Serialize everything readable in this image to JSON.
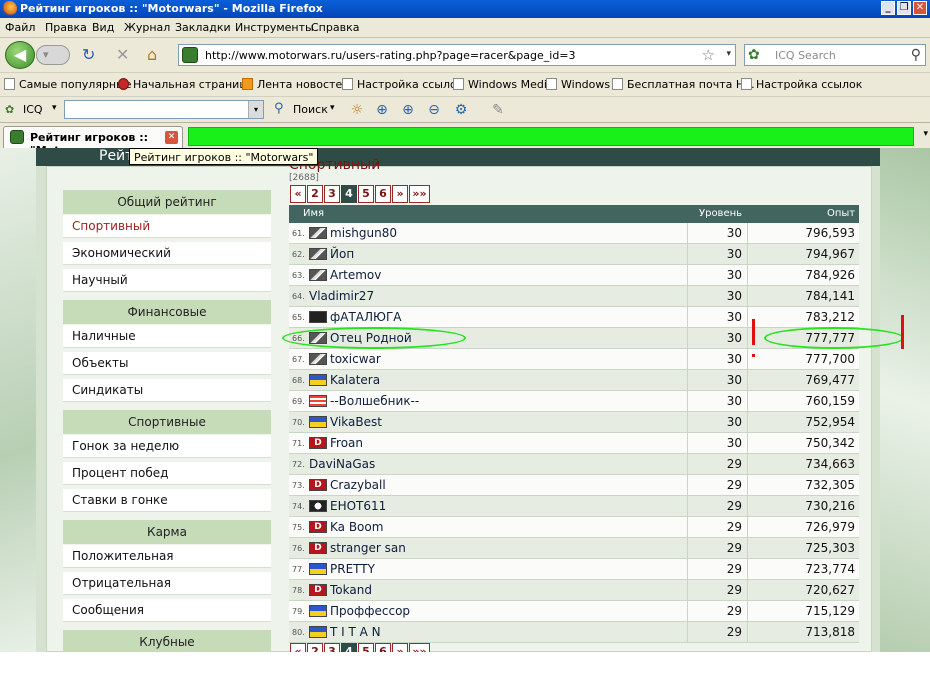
{
  "window": {
    "title": "Рейтинг игроков :: \"Motorwars\" - Mozilla Firefox",
    "btn_min": "_",
    "btn_max": "❐",
    "btn_close": "✕"
  },
  "menu": [
    "Файл",
    "Правка",
    "Вид",
    "Журнал",
    "Закладки",
    "Инструменты",
    "Справка"
  ],
  "nav": {
    "back": "◀",
    "forward": "▾",
    "reload": "↻",
    "stop": "✕",
    "home": "⌂",
    "url": "http://www.motorwars.ru/users-rating.php?page=racer&page_id=3",
    "star": "☆",
    "dropdown": "▾",
    "search_placeholder": "ICQ Search",
    "search_gear": "✿",
    "search_icon": "⚲"
  },
  "bookmarks": [
    "Самые популярные",
    "Начальная страница",
    "Лента новостей",
    "Настройка ссылок",
    "Windows Media",
    "Windows",
    "Бесплатная почта Н...",
    "Настройка ссылок"
  ],
  "icq_toolbar": {
    "label": "ICQ",
    "dropdown": "▾",
    "search_label": "Поиск",
    "icons": [
      "✿",
      "☼",
      "⊕",
      "⊖",
      "⚙",
      "✎"
    ]
  },
  "tabs": {
    "active_label": "Рейтинг игроков :: \"Mot...",
    "close": "✕",
    "tooltip": "Рейтинг игроков :: \"Motorwars\"",
    "scroll": "▾"
  },
  "page": {
    "header_title": "Рейтинг",
    "section_title": "Спортивный",
    "total": "[2688]",
    "pager": [
      "«",
      "2",
      "3",
      "4",
      "5",
      "6",
      "»",
      "»»"
    ],
    "pager_current": "4",
    "columns": [
      "Имя",
      "Уровень",
      "Опыт"
    ]
  },
  "sidebar": {
    "groups": [
      {
        "title": "Общий рейтинг",
        "items": [
          "Спортивный",
          "Экономический",
          "Научный"
        ]
      },
      {
        "title": "Финансовые",
        "items": [
          "Наличные",
          "Объекты",
          "Синдикаты"
        ]
      },
      {
        "title": "Спортивные",
        "items": [
          "Гонок за неделю",
          "Процент побед",
          "Ставки в гонке"
        ]
      },
      {
        "title": "Карма",
        "items": [
          "Положительная",
          "Отрицательная",
          "Сообщения"
        ]
      },
      {
        "title": "Клубные",
        "items": []
      }
    ],
    "active_item": "Спортивный"
  },
  "rows": [
    {
      "rank": "61.",
      "flag": "car",
      "name": "mishgun80",
      "level": "30",
      "xp": "796,593"
    },
    {
      "rank": "62.",
      "flag": "car",
      "name": "Йоп",
      "level": "30",
      "xp": "794,967"
    },
    {
      "rank": "63.",
      "flag": "car",
      "name": "Artemov",
      "level": "30",
      "xp": "784,926"
    },
    {
      "rank": "64.",
      "flag": "",
      "name": "Vladimir27",
      "level": "30",
      "xp": "784,141"
    },
    {
      "rank": "65.",
      "flag": "pirate",
      "name": "фАТАЛЮГА",
      "level": "30",
      "xp": "783,212"
    },
    {
      "rank": "66.",
      "flag": "car",
      "name": "Отец Родной",
      "level": "30",
      "xp": "777,777"
    },
    {
      "rank": "67.",
      "flag": "car",
      "name": "toxicwar",
      "level": "30",
      "xp": "777,700"
    },
    {
      "rank": "68.",
      "flag": "ua",
      "name": "Kalatera",
      "level": "30",
      "xp": "769,477"
    },
    {
      "rank": "69.",
      "flag": "stripe",
      "name": "--Волшебник--",
      "level": "30",
      "xp": "760,159"
    },
    {
      "rank": "70.",
      "flag": "ua",
      "name": "VikaBest",
      "level": "30",
      "xp": "752,954"
    },
    {
      "rank": "71.",
      "flag": "d",
      "name": "Froan",
      "level": "30",
      "xp": "750,342"
    },
    {
      "rank": "72.",
      "flag": "",
      "name": "DaviNaGas",
      "level": "29",
      "xp": "734,663"
    },
    {
      "rank": "73.",
      "flag": "d",
      "name": "Crazyball",
      "level": "29",
      "xp": "732,305"
    },
    {
      "rank": "74.",
      "flag": "skull",
      "name": "ЕНОТ611",
      "level": "29",
      "xp": "730,216"
    },
    {
      "rank": "75.",
      "flag": "d",
      "name": "Ka Boom",
      "level": "29",
      "xp": "726,979"
    },
    {
      "rank": "76.",
      "flag": "d",
      "name": "stranger san",
      "level": "29",
      "xp": "725,303"
    },
    {
      "rank": "77.",
      "flag": "ua",
      "name": "PRETTY",
      "level": "29",
      "xp": "723,774"
    },
    {
      "rank": "78.",
      "flag": "d",
      "name": "Tokand",
      "level": "29",
      "xp": "720,627"
    },
    {
      "rank": "79.",
      "flag": "ua",
      "name": "Проффессор",
      "level": "29",
      "xp": "715,129"
    },
    {
      "rank": "80.",
      "flag": "ua",
      "name": "T I T A N",
      "level": "29",
      "xp": "713,818"
    }
  ],
  "colors": {
    "accent": "#7a1414",
    "table_header": "#426560",
    "annotation": "#27e41c",
    "marker": "#e01010"
  }
}
